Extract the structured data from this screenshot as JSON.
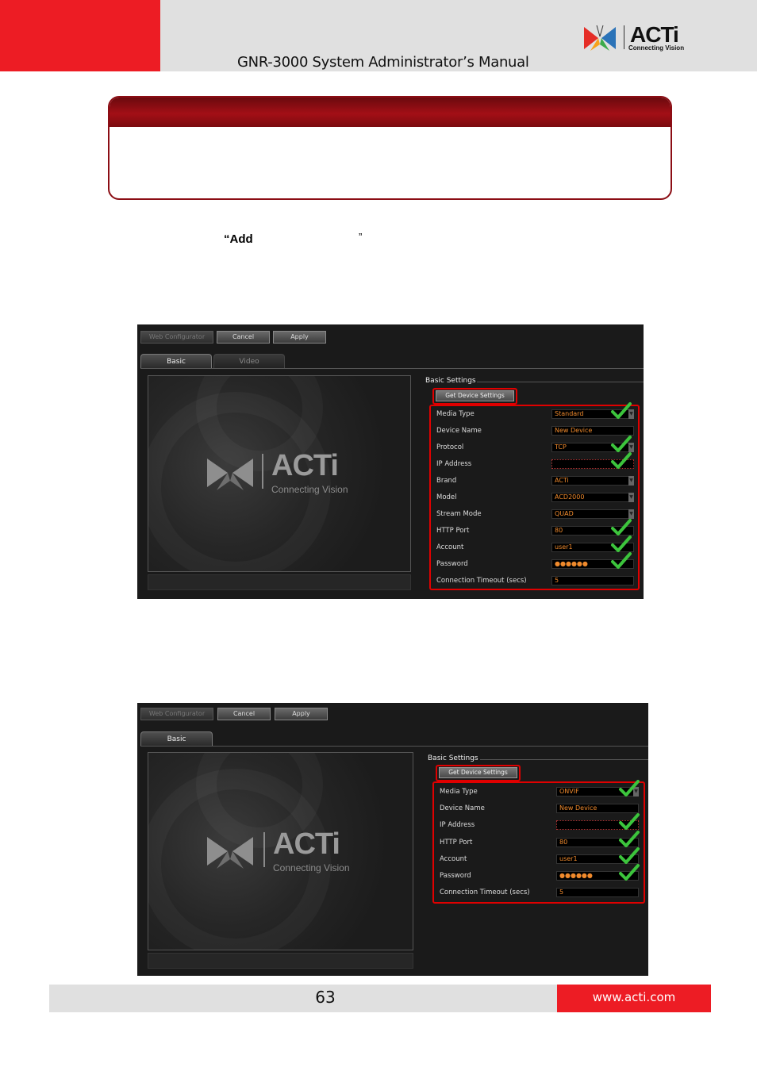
{
  "header": {
    "title": "GNR-3000 System Administrator’s Manual",
    "logo_word": "ACTi",
    "logo_tagline": "Connecting Vision"
  },
  "body": {
    "add_text": "“Add",
    "close_quote": "”"
  },
  "shot1": {
    "toolbar": {
      "web_configurator": "Web Configurator",
      "cancel": "Cancel",
      "apply": "Apply"
    },
    "tabs": {
      "basic": "Basic",
      "video": "Video"
    },
    "preview": {
      "logo_word": "ACTi",
      "logo_tagline": "Connecting Vision"
    },
    "section_title": "Basic Settings",
    "get_settings": "Get Device Settings",
    "fields": [
      {
        "label": "Media Type",
        "value": "Standard"
      },
      {
        "label": "Device Name",
        "value": "New Device"
      },
      {
        "label": "Protocol",
        "value": "TCP"
      },
      {
        "label": "IP Address",
        "value": ""
      },
      {
        "label": "Brand",
        "value": "ACTi"
      },
      {
        "label": "Model",
        "value": "ACD2000"
      },
      {
        "label": "Stream Mode",
        "value": "QUAD"
      },
      {
        "label": "HTTP Port",
        "value": "80"
      },
      {
        "label": "Account",
        "value": "user1"
      },
      {
        "label": "Password",
        "value": "●●●●●●"
      },
      {
        "label": "Connection Timeout (secs)",
        "value": "5"
      }
    ]
  },
  "shot2": {
    "toolbar": {
      "web_configurator": "Web Configurator",
      "cancel": "Cancel",
      "apply": "Apply"
    },
    "tabs": {
      "basic": "Basic"
    },
    "preview": {
      "logo_word": "ACTi",
      "logo_tagline": "Connecting Vision"
    },
    "section_title": "Basic Settings",
    "get_settings": "Get Device Settings",
    "fields": [
      {
        "label": "Media Type",
        "value": "ONVIF"
      },
      {
        "label": "Device Name",
        "value": "New Device"
      },
      {
        "label": "IP Address",
        "value": ""
      },
      {
        "label": "HTTP Port",
        "value": "80"
      },
      {
        "label": "Account",
        "value": "user1"
      },
      {
        "label": "Password",
        "value": "●●●●●●"
      },
      {
        "label": "Connection Timeout (secs)",
        "value": "5"
      }
    ]
  },
  "footer": {
    "page_number": "63",
    "url": "www.acti.com"
  },
  "colors": {
    "brand_red": "#ed1c24",
    "note_dark_red": "#8b0d14",
    "field_text": "#f08a2c",
    "highlight_red": "#e00000",
    "check_green": "#3cc43c"
  }
}
